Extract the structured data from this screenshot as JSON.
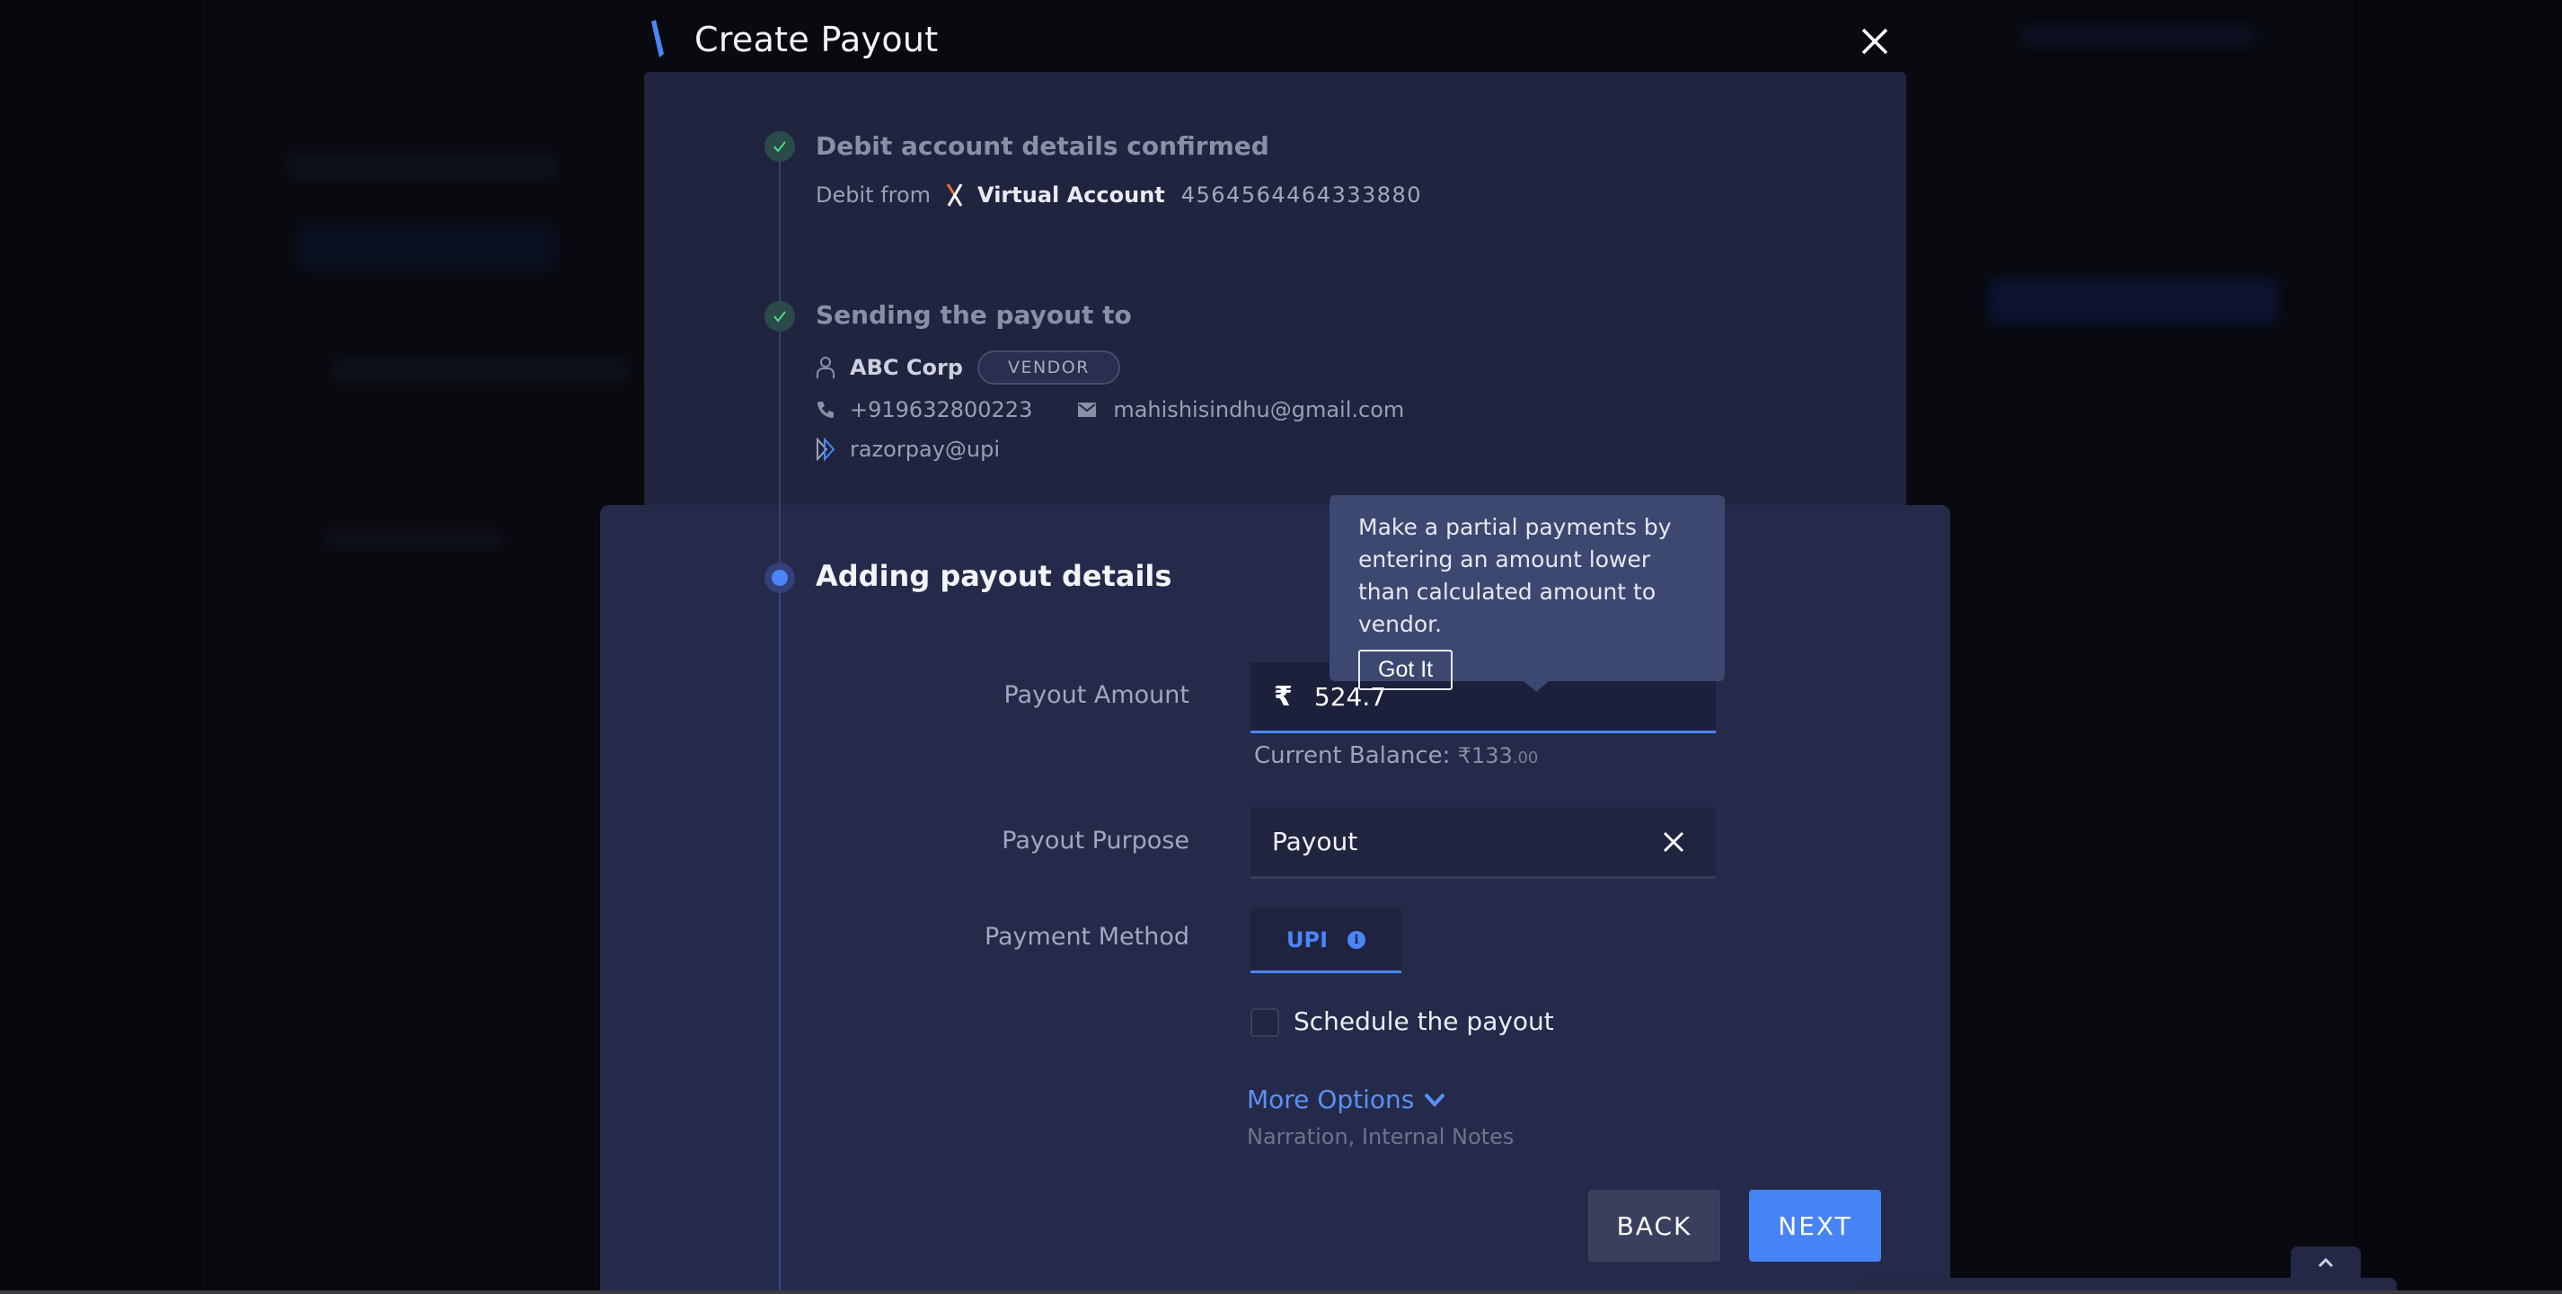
{
  "modal": {
    "title": "Create Payout",
    "close_icon": "close-icon",
    "logo_icon": "slash-logo-icon"
  },
  "steps": [
    {
      "status": "done",
      "title": "Debit account details confirmed",
      "debit_from_label": "Debit from",
      "account_icon": "virtual-account-x-icon",
      "account_type": "Virtual Account",
      "account_number": "4564564464333880"
    },
    {
      "status": "done",
      "title": "Sending the payout to",
      "contact_name": "ABC Corp",
      "contact_type_badge": "VENDOR",
      "phone": "+919632800223",
      "email": "mahishisindhu@gmail.com",
      "vpa": "razorpay@upi"
    },
    {
      "status": "active",
      "title": "Adding payout details"
    }
  ],
  "form": {
    "payout_amount": {
      "label": "Payout Amount",
      "currency_symbol": "₹",
      "value": "524.7"
    },
    "balance": {
      "label": "Current Balance:",
      "currency_symbol": "₹",
      "amount_whole": "133",
      "amount_decimal": ".00"
    },
    "payout_purpose": {
      "label": "Payout Purpose",
      "value": "Payout"
    },
    "payment_method": {
      "label": "Payment Method",
      "selected": "UPI",
      "info_icon_glyph": "i"
    },
    "schedule": {
      "label": "Schedule the payout",
      "checked": false
    },
    "more_options": {
      "label": "More Options",
      "sublabel": "Narration, Internal Notes"
    }
  },
  "tooltip": {
    "text": "Make a partial payments by entering an amount lower than calculated amount to vendor.",
    "button_label": "Got It"
  },
  "actions": {
    "back_label": "BACK",
    "next_label": "NEXT"
  },
  "colors": {
    "accent": "#4683f4",
    "success": "#4ade80",
    "panel": "#252a4a",
    "panel_top": "#20243f",
    "tooltip_bg": "#3c4870"
  }
}
